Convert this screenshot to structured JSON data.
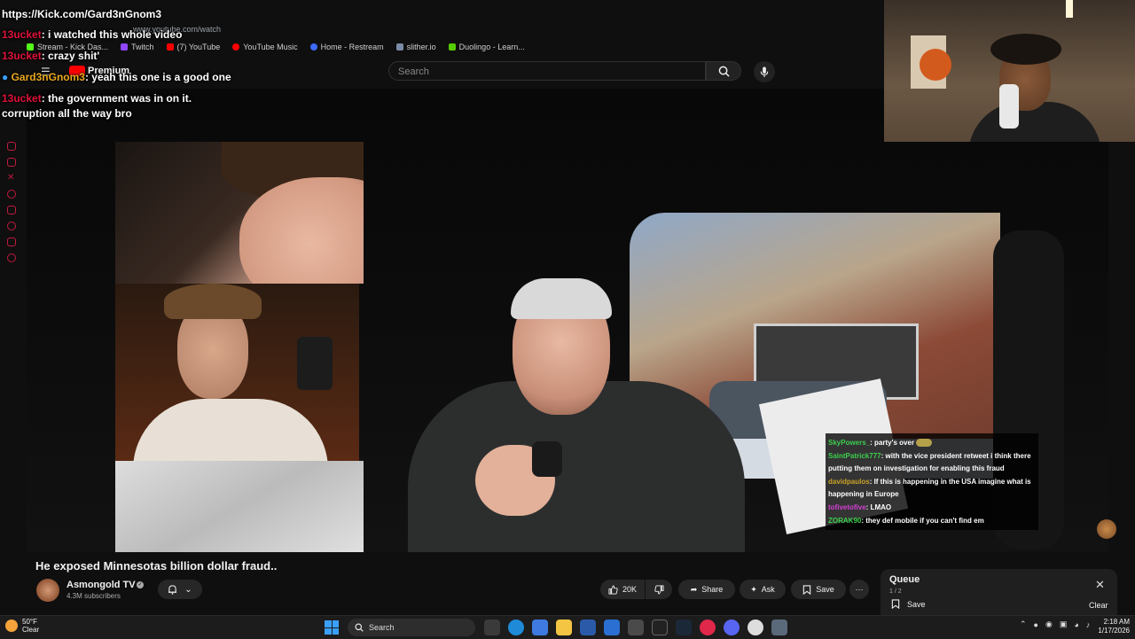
{
  "browser": {
    "url": "www.youtube.com/watch",
    "bookmarks": [
      {
        "label": "Stream - Kick Das...",
        "color": "#53fc18"
      },
      {
        "label": "Twitch",
        "color": "#9146ff"
      },
      {
        "label": "(7) YouTube",
        "color": "#ff0000"
      },
      {
        "label": "YouTube Music",
        "color": "#ff0000"
      },
      {
        "label": "Home - Restream",
        "color": "#3b6bff"
      },
      {
        "label": "slither.io",
        "color": "#7a8aa8"
      },
      {
        "label": "Duolingo - Learn...",
        "color": "#58cc02"
      }
    ]
  },
  "youtube": {
    "logo_label": "Premium",
    "search_placeholder": "Search"
  },
  "chat_overlay": {
    "url_line": "https://Kick.com/Gard3nGnom3",
    "messages": [
      {
        "user": "13ucket",
        "text": ": i watched this whole video",
        "color": "#e0123a"
      },
      {
        "user": "13ucket",
        "text": ": crazy shit'",
        "color": "#e0123a"
      },
      {
        "user": "Gard3nGnom3",
        "text": ": yeah this one is a good one",
        "color": "#e8a820"
      },
      {
        "user": "13ucket",
        "text": ": the government was in on it. corruption all the way bro",
        "color": "#e0123a"
      }
    ]
  },
  "stream_chat": {
    "messages": [
      {
        "user": "SkyPowers_",
        "text": ": party's over",
        "color": "#3ccf4e"
      },
      {
        "user": "SaintPatrick777",
        "text": ": with the vice president retweet i think there putting them on investigation for enabling this fraud",
        "color": "#3ccf4e"
      },
      {
        "user": "davidpaulos",
        "text": ": If this is happening in the USA imagine what is happening in Europe",
        "color": "#c9a227"
      },
      {
        "user": "tofivetofive",
        "text": ": LMAO",
        "color": "#d63fd6"
      },
      {
        "user": "ZORAK90",
        "text": ": they def mobile if you can't find em",
        "color": "#3ccf4e"
      }
    ]
  },
  "video": {
    "title": "He exposed Minnesotas billion dollar fraud..",
    "channel_name": "Asmongold TV",
    "subscribers": "4.3M subscribers",
    "likes": "20K",
    "share_label": "Share",
    "ask_label": "Ask",
    "save_label": "Save"
  },
  "queue": {
    "title": "Queue",
    "count": "1 / 2",
    "save_label": "Save",
    "clear_label": "Clear"
  },
  "taskbar": {
    "temperature": "50°F",
    "weather": "Clear",
    "search_label": "Search",
    "time": "2:18 AM",
    "date": "1/17/2026"
  }
}
